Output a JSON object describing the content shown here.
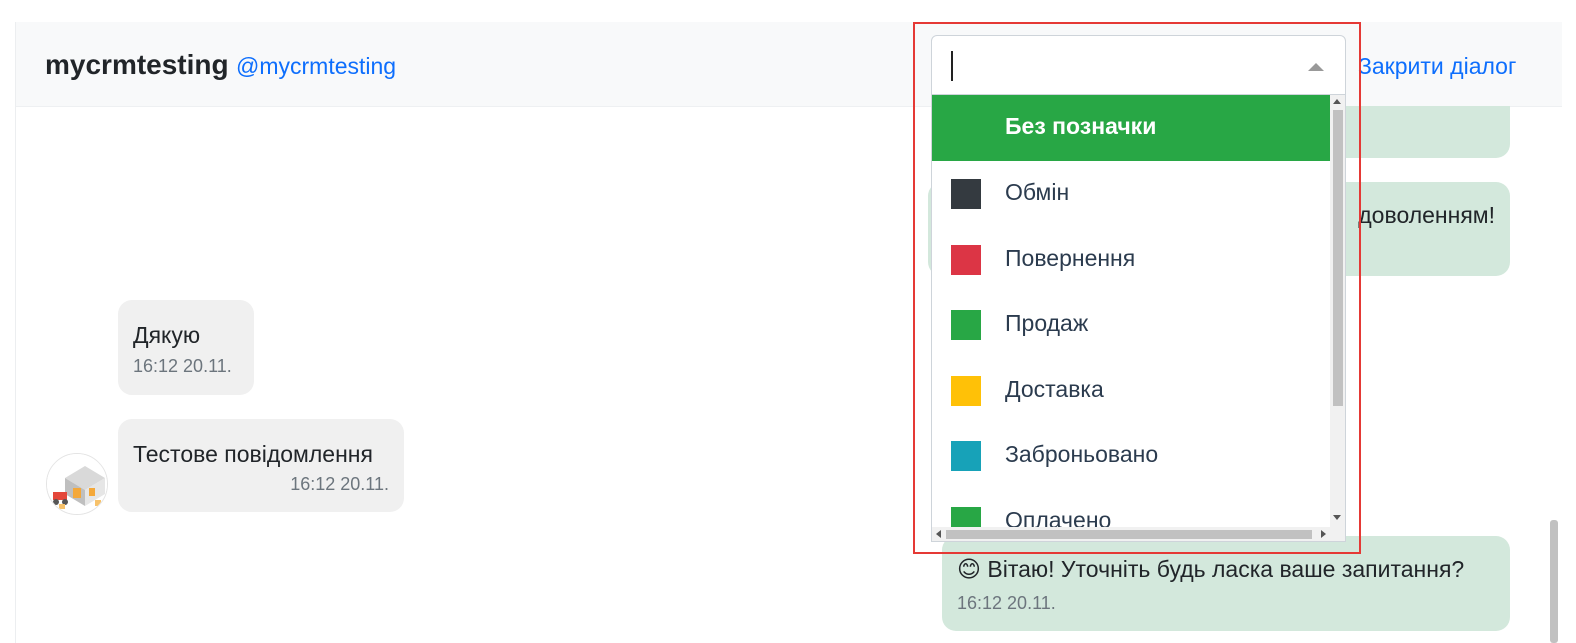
{
  "header": {
    "contact_name": "mycrmtesting",
    "contact_handle": "@mycrmtesting",
    "close_label": "Закрити діалог"
  },
  "messages": [
    {
      "direction": "in",
      "text": "Дякую",
      "time": "16:12 20.11."
    },
    {
      "direction": "in",
      "text": "Тестове повідомлення",
      "time": "16:12 20.11."
    },
    {
      "direction": "out",
      "text_partial": "доволенням!"
    },
    {
      "direction": "out",
      "emoji": "😊",
      "text": "Вітаю! Уточніть будь ласка ваше запитання?",
      "time": "16:12 20.11."
    }
  ],
  "tag_select": {
    "input_value": "",
    "options": [
      {
        "label": "Без позначки",
        "color": "",
        "selected": true
      },
      {
        "label": "Обмін",
        "color": "#343a40"
      },
      {
        "label": "Повернення",
        "color": "#dc3545"
      },
      {
        "label": "Продаж",
        "color": "#28a745"
      },
      {
        "label": "Доставка",
        "color": "#ffc107"
      },
      {
        "label": "Заброньовано",
        "color": "#17a2b8"
      },
      {
        "label": "Оплачено",
        "color": "#28a745"
      }
    ],
    "selected_color": "#28a745"
  },
  "colors": {
    "link": "#0d6efd",
    "incoming_bubble": "#f0f0f0",
    "outgoing_bubble": "#d3e8dc",
    "highlight": "#e53935"
  }
}
